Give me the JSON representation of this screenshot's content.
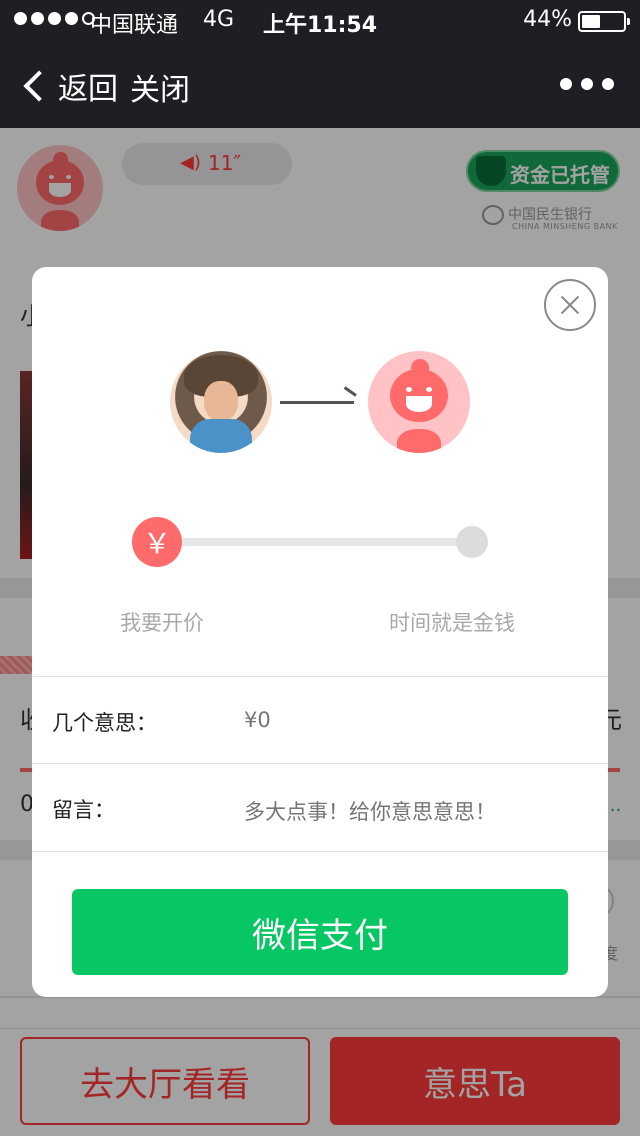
{
  "status_bar": {
    "carrier": "中国联通",
    "network": "4G",
    "time": "上午11:54",
    "battery_percent": "44%",
    "battery_level": 0.44
  },
  "nav": {
    "back_label": "返回",
    "close_label": "关闭"
  },
  "background": {
    "voice_duration": "11″",
    "fund_badge": "资金已托管",
    "bank_name": "中国民生银行",
    "bank_en": "CHINA MINSHENG BANK",
    "text_1": "小",
    "text_2_left": "收",
    "text_2_right": "元",
    "text_3": "0",
    "dots": "···",
    "small_text": "度",
    "bottom_left_button": "去大厅看看",
    "bottom_right_button": "意思Ta"
  },
  "modal": {
    "currency_symbol": "￥",
    "slider_label_left": "我要开价",
    "slider_label_right": "时间就是金钱",
    "amount_label": "几个意思：",
    "amount_placeholder": "¥0",
    "message_label": "留言：",
    "message_placeholder": "多大点事！给你意思意思！",
    "pay_button": "微信支付"
  },
  "colors": {
    "accent_red": "#ff6b6b",
    "wechat_green": "#06c763",
    "nav_dark": "#1e1e24"
  },
  "icons": {
    "back": "chevron-left-icon",
    "more": "more-dots-icon",
    "close": "close-circle-icon",
    "voice": "voice-wave-icon",
    "shield": "shield-icon",
    "arrow": "arrow-right-icon"
  }
}
